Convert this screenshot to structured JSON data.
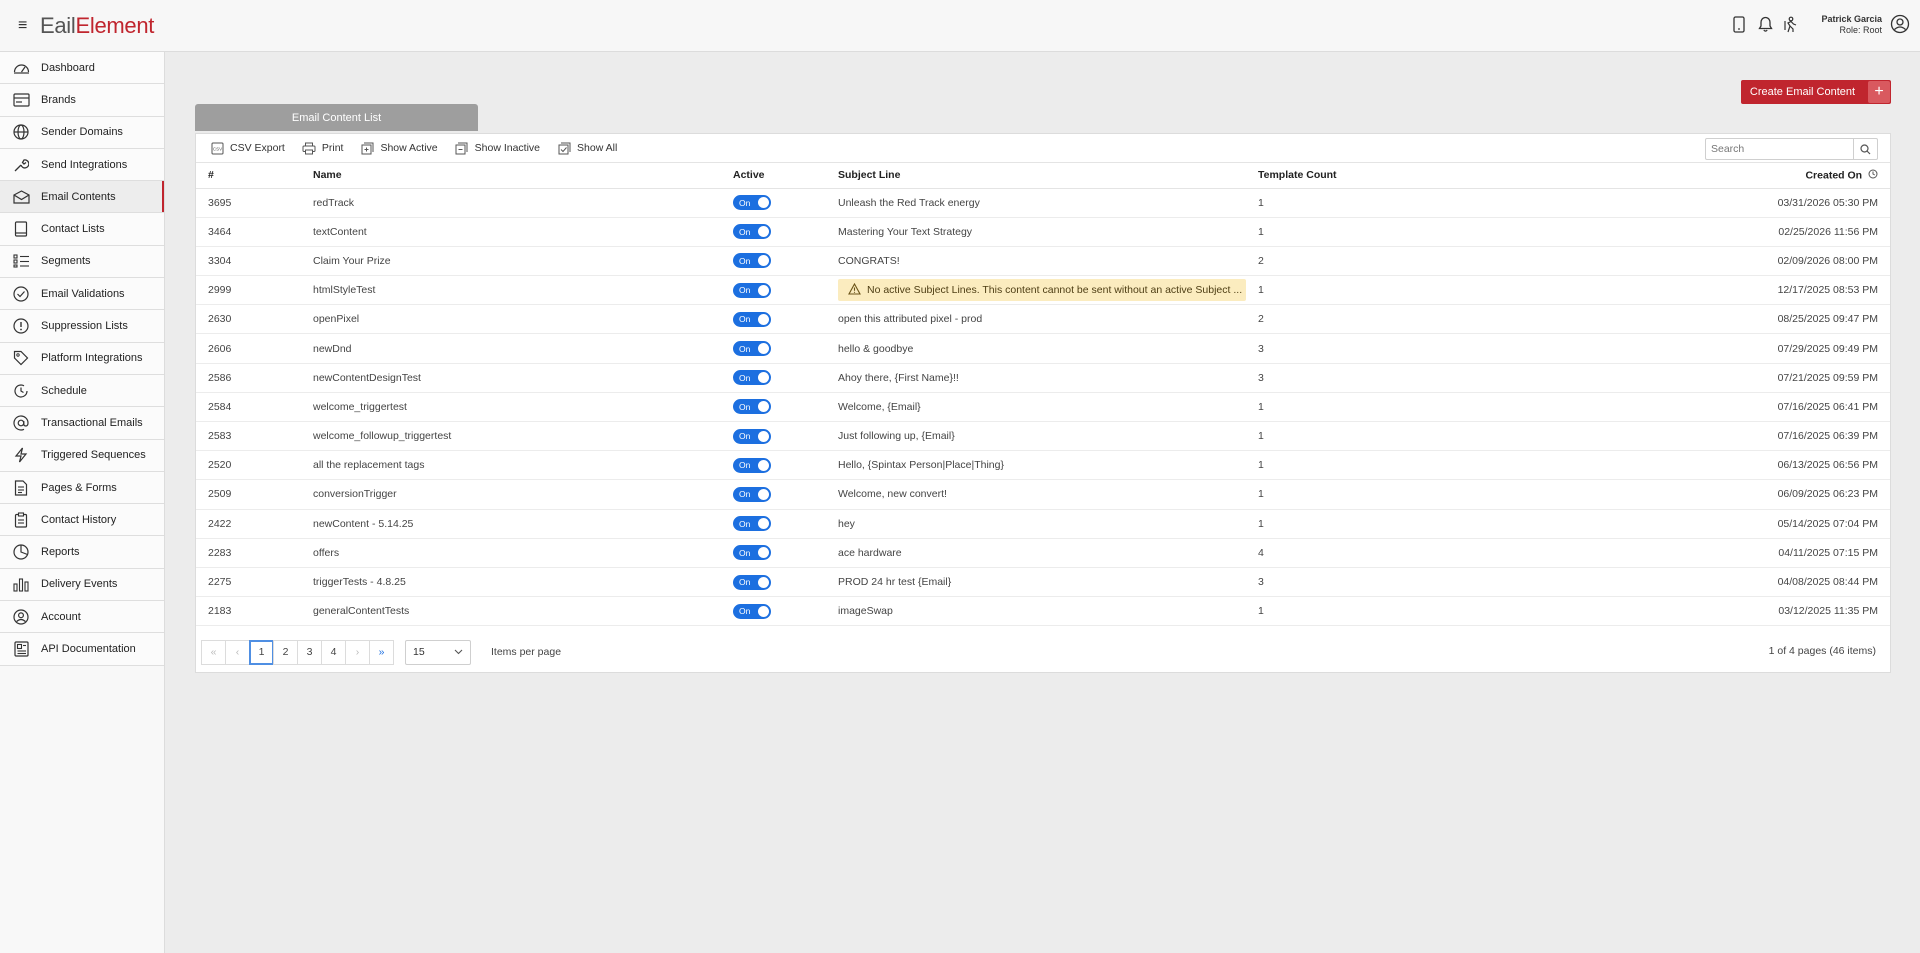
{
  "header": {
    "logo_prefix": "E",
    "logo_mail": "ail",
    "logo_element": "Element",
    "user_name": "Patrick Garcia",
    "user_role": "Role: Root",
    "icons": [
      "mobile-icon",
      "bell-icon",
      "logout-icon",
      "user-circle-icon"
    ]
  },
  "sidebar": {
    "items": [
      {
        "label": "Dashboard",
        "icon": "dashboard-icon"
      },
      {
        "label": "Brands",
        "icon": "brands-icon"
      },
      {
        "label": "Sender Domains",
        "icon": "globe-icon"
      },
      {
        "label": "Send Integrations",
        "icon": "wrench-icon"
      },
      {
        "label": "Email Contents",
        "icon": "envelope-icon",
        "active": true
      },
      {
        "label": "Contact Lists",
        "icon": "book-icon"
      },
      {
        "label": "Segments",
        "icon": "segments-icon"
      },
      {
        "label": "Email Validations",
        "icon": "check-circle-icon"
      },
      {
        "label": "Suppression Lists",
        "icon": "exclamation-circle-icon"
      },
      {
        "label": "Platform Integrations",
        "icon": "tag-icon"
      },
      {
        "label": "Schedule",
        "icon": "clock-history-icon"
      },
      {
        "label": "Transactional Emails",
        "icon": "at-icon"
      },
      {
        "label": "Triggered Sequences",
        "icon": "lightning-icon"
      },
      {
        "label": "Pages & Forms",
        "icon": "document-icon"
      },
      {
        "label": "Contact History",
        "icon": "clipboard-icon"
      },
      {
        "label": "Reports",
        "icon": "pie-chart-icon"
      },
      {
        "label": "Delivery Events",
        "icon": "bar-chart-icon"
      },
      {
        "label": "Account",
        "icon": "account-icon"
      },
      {
        "label": "API Documentation",
        "icon": "api-doc-icon"
      }
    ]
  },
  "create_button": {
    "label": "Create Email Content",
    "plus": "+"
  },
  "tab": {
    "label": "Email Content List"
  },
  "toolbar": {
    "csv_export": "CSV Export",
    "print": "Print",
    "show_active": "Show Active",
    "show_inactive": "Show Inactive",
    "show_all": "Show All",
    "search_placeholder": "Search"
  },
  "table": {
    "headers": {
      "id": "#",
      "name": "Name",
      "active": "Active",
      "subject": "Subject Line",
      "template_count": "Template Count",
      "created_on": "Created On"
    },
    "toggle_label": "On",
    "rows": [
      {
        "id": "3695",
        "name": "redTrack",
        "subject": "Unleash the Red Track energy",
        "template_count": "1",
        "created_on": "03/31/2026 05:30 PM"
      },
      {
        "id": "3464",
        "name": "textContent",
        "subject": "Mastering Your Text Strategy",
        "template_count": "1",
        "created_on": "02/25/2026 11:56 PM"
      },
      {
        "id": "3304",
        "name": "Claim Your Prize",
        "subject": "CONGRATS!",
        "template_count": "2",
        "created_on": "02/09/2026 08:00 PM"
      },
      {
        "id": "2999",
        "name": "htmlStyleTest",
        "subject": "No active Subject Lines. This content cannot be sent without an active Subject ...",
        "warning": true,
        "template_count": "1",
        "created_on": "12/17/2025 08:53 PM"
      },
      {
        "id": "2630",
        "name": "openPixel",
        "subject": "open this attributed pixel - prod",
        "template_count": "2",
        "created_on": "08/25/2025 09:47 PM"
      },
      {
        "id": "2606",
        "name": "newDnd",
        "subject": "hello & goodbye",
        "template_count": "3",
        "created_on": "07/29/2025 09:49 PM"
      },
      {
        "id": "2586",
        "name": "newContentDesignTest",
        "subject": "Ahoy there, {First Name}!!",
        "template_count": "3",
        "created_on": "07/21/2025 09:59 PM"
      },
      {
        "id": "2584",
        "name": "welcome_triggertest",
        "subject": "Welcome, {Email}",
        "template_count": "1",
        "created_on": "07/16/2025 06:41 PM"
      },
      {
        "id": "2583",
        "name": "welcome_followup_triggertest",
        "subject": "Just following up, {Email}",
        "template_count": "1",
        "created_on": "07/16/2025 06:39 PM"
      },
      {
        "id": "2520",
        "name": "all the replacement tags",
        "subject": "Hello, {Spintax Person|Place|Thing}",
        "template_count": "1",
        "created_on": "06/13/2025 06:56 PM"
      },
      {
        "id": "2509",
        "name": "conversionTrigger",
        "subject": "Welcome, new convert!",
        "template_count": "1",
        "created_on": "06/09/2025 06:23 PM"
      },
      {
        "id": "2422",
        "name": "newContent - 5.14.25",
        "subject": "hey",
        "template_count": "1",
        "created_on": "05/14/2025 07:04 PM"
      },
      {
        "id": "2283",
        "name": "offers",
        "subject": "ace hardware",
        "template_count": "4",
        "created_on": "04/11/2025 07:15 PM"
      },
      {
        "id": "2275",
        "name": "triggerTests - 4.8.25",
        "subject": "PROD 24 hr test {Email}",
        "template_count": "3",
        "created_on": "04/08/2025 08:44 PM"
      },
      {
        "id": "2183",
        "name": "generalContentTests",
        "subject": "imageSwap",
        "template_count": "1",
        "created_on": "03/12/2025 11:35 PM"
      }
    ]
  },
  "pager": {
    "first": "«",
    "prev": "‹",
    "next": "›",
    "last": "»",
    "pages": [
      "1",
      "2",
      "3",
      "4"
    ],
    "current_page": "1",
    "page_size": "15",
    "items_per_page_label": "Items per page",
    "info": "1 of 4 pages (46 items)"
  }
}
